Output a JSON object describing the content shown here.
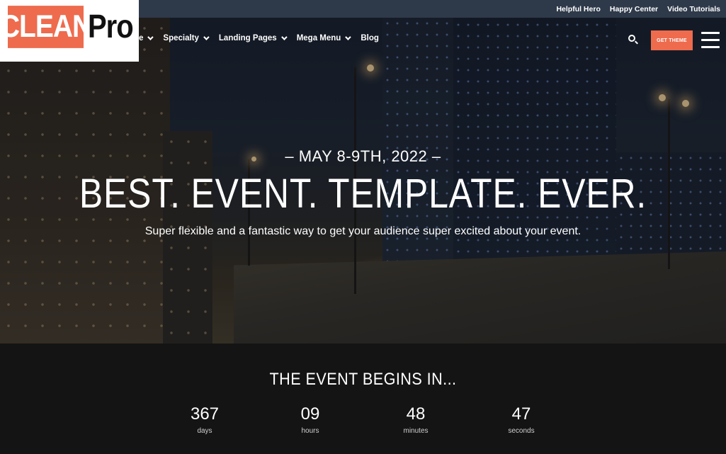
{
  "topbar": {
    "links": [
      "Helpful Hero",
      "Happy Center",
      "Video Tutorials"
    ]
  },
  "logo": {
    "part1": "CLEAN",
    "part2": "Pro"
  },
  "nav": {
    "items": [
      {
        "label": "e",
        "has_dropdown": true
      },
      {
        "label": "Specialty",
        "has_dropdown": true
      },
      {
        "label": "Landing Pages",
        "has_dropdown": true
      },
      {
        "label": "Mega Menu",
        "has_dropdown": true
      },
      {
        "label": "Blog",
        "has_dropdown": false
      }
    ],
    "cta": "GET THEME"
  },
  "hero": {
    "date": "– MAY 8-9TH, 2022 –",
    "headline": "BEST. EVENT. TEMPLATE. EVER.",
    "subline": "Super flexible and a fantastic way to get your audience super excited about your event."
  },
  "countdown": {
    "title": "THE EVENT BEGINS IN...",
    "units": [
      {
        "value": "367",
        "label": "days"
      },
      {
        "value": "09",
        "label": "hours"
      },
      {
        "value": "48",
        "label": "minutes"
      },
      {
        "value": "47",
        "label": "seconds"
      }
    ]
  },
  "colors": {
    "accent": "#ee6b4d",
    "topbar": "#2e3a4a",
    "countdown_bg": "#141414"
  },
  "icons": [
    "search-icon",
    "hamburger-menu-icon",
    "chevron-down-icon"
  ]
}
